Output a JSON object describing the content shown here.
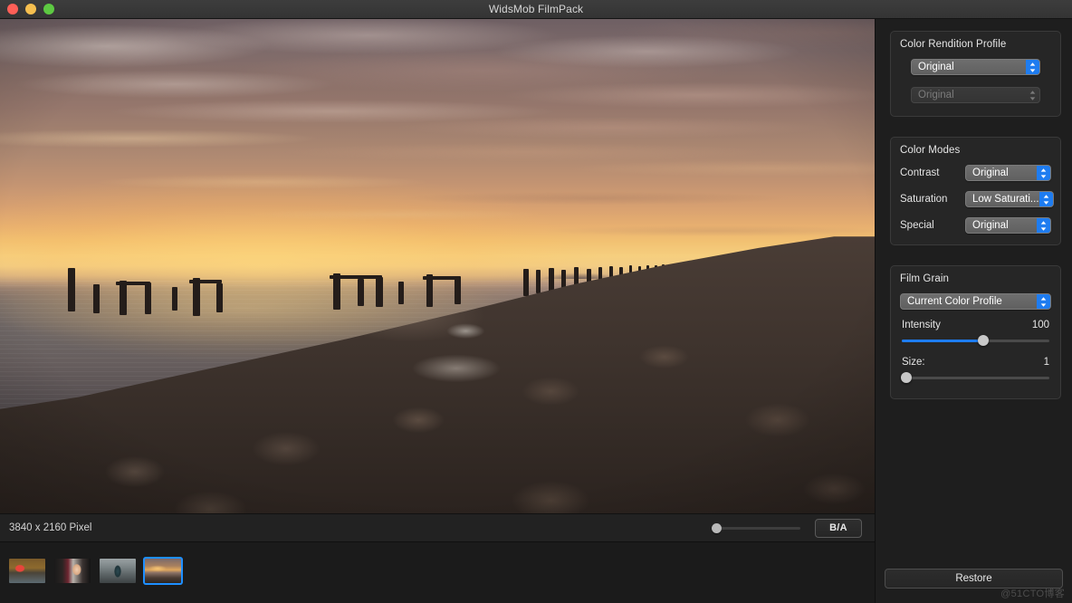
{
  "window": {
    "title": "WidsMob FilmPack",
    "traffic_lights": [
      "close",
      "minimize",
      "maximize"
    ]
  },
  "canvas": {
    "photo_description": "Sunset seascape with rock breakwater jetty and weathered pier pilings"
  },
  "status_bar": {
    "dimensions": "3840 x 2160 Pixel",
    "compare_button": "B/A",
    "compare_slider_value": 0
  },
  "filmstrip": {
    "thumbnails": [
      {
        "name": "thumb-autumn-umbrella",
        "selected": false
      },
      {
        "name": "thumb-portrait-woman",
        "selected": false
      },
      {
        "name": "thumb-bridge-person",
        "selected": false
      },
      {
        "name": "thumb-sunset-jetty",
        "selected": true
      }
    ]
  },
  "panels": {
    "color_rendition_profile": {
      "title": "Color Rendition Profile",
      "profile": "Original",
      "sub_profile": "Original",
      "sub_disabled": true
    },
    "color_modes": {
      "title": "Color Modes",
      "rows": [
        {
          "label": "Contrast",
          "value": "Original"
        },
        {
          "label": "Saturation",
          "value": "Low Saturati..."
        },
        {
          "label": "Special",
          "value": "Original"
        }
      ]
    },
    "film_grain": {
      "title": "Film Grain",
      "profile": "Current Color Profile",
      "intensity_label": "Intensity",
      "intensity_value": "100",
      "intensity_percent": 55,
      "size_label": "Size:",
      "size_value": "1",
      "size_percent": 2
    }
  },
  "actions": {
    "restore": "Restore"
  },
  "watermark": "@51CTO博客",
  "colors": {
    "accent": "#1e7cf0",
    "selection": "#1e8fff",
    "panel_bg": "#262626",
    "window_bg": "#1e1e1e"
  }
}
